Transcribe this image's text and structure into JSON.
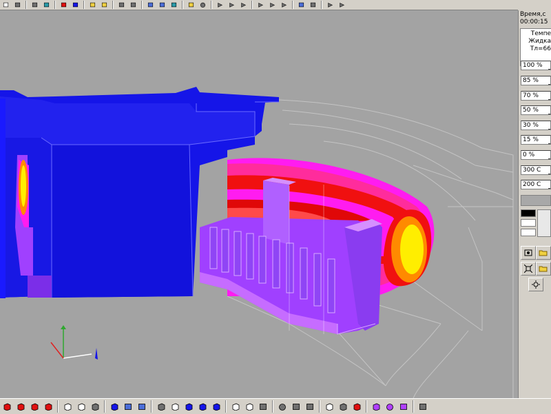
{
  "panel": {
    "time_label": "Время,с",
    "time_value": "00:00:15",
    "info_lines": [
      "Темпе",
      "Жидка",
      "Тл=66"
    ]
  },
  "legend": {
    "levels": [
      "100 %",
      "85 %",
      "70 %",
      "50 %",
      "30 %",
      "15 %",
      "0 %",
      "300 С",
      "200 С"
    ],
    "swatch_colors": [
      "#000000",
      "#ffffff",
      "#ffffff"
    ]
  },
  "colors": {
    "viewport_bg": "#a3a3a3",
    "mold_blue": "#1515e8",
    "magenta": "#ff1cf0",
    "violet": "#a040ff",
    "red": "#f01010",
    "yellow": "#ffee00",
    "orange": "#ff8a00",
    "ui_face": "#d4d0c8"
  },
  "icons": {
    "top": [
      "new-icon",
      "open-icon",
      "sep",
      "graph-icon",
      "image-icon",
      "sep",
      "red-part-icon",
      "blue-part-icon",
      "sep",
      "folder-open-icon",
      "folder-save-icon",
      "sep",
      "frame-icon",
      "window-icon",
      "sep",
      "table-icon",
      "chart-icon",
      "monitor-icon",
      "sep",
      "help-icon",
      "camera-icon",
      "sep",
      "align-top-icon",
      "align-bottom-icon",
      "align-center-icon",
      "sep",
      "arrow-down-icon",
      "arrow-up-icon",
      "arrow-split-icon",
      "sep",
      "grid-icon",
      "dots-icon",
      "sep",
      "play-icon",
      "more-icon"
    ],
    "bottom": [
      "red-box-icon",
      "red-box-icon",
      "red-box-icon",
      "red-box-icon",
      "sep",
      "box-outline-icon",
      "box-outline-icon",
      "box-grey-icon",
      "sep",
      "box-blue-icon",
      "grid-fine-icon",
      "grid-coarse-icon",
      "sep",
      "cube-icon",
      "box-white-icon",
      "cube-blue-icon",
      "cube-blue-icon",
      "cube-blue-icon",
      "sep",
      "cube-outline-icon",
      "cube-outline-icon",
      "cylinder-icon",
      "sep",
      "rotate-icon",
      "pan-icon",
      "zoom-icon",
      "sep",
      "cube-white-icon",
      "cube-cross-icon",
      "cube-red-icon",
      "sep",
      "color-cube-icon",
      "color-sphere-icon",
      "color-pyramid-icon",
      "sep",
      "fit-view-icon"
    ]
  }
}
